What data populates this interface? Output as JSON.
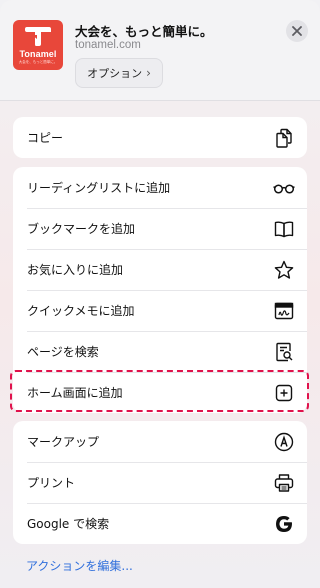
{
  "header": {
    "app_brand": "Tonamel",
    "app_tagline": "大会を、もっと簡単に。",
    "title": "大会を、もっと簡単に。",
    "url": "tonamel.com",
    "options_label": "オプション",
    "options_chevron": "›"
  },
  "groups": [
    {
      "items": [
        {
          "label": "コピー",
          "icon": "copy-icon"
        }
      ]
    },
    {
      "items": [
        {
          "label": "リーディングリストに追加",
          "icon": "glasses-icon"
        },
        {
          "label": "ブックマークを追加",
          "icon": "book-icon"
        },
        {
          "label": "お気に入りに追加",
          "icon": "star-icon"
        },
        {
          "label": "クイックメモに追加",
          "icon": "quick-note-icon"
        },
        {
          "label": "ページを検索",
          "icon": "find-in-page-icon"
        },
        {
          "label": "ホーム画面に追加",
          "icon": "plus-square-icon"
        }
      ]
    },
    {
      "items": [
        {
          "label": "マークアップ",
          "icon": "markup-pen-icon"
        },
        {
          "label": "プリント",
          "icon": "printer-icon"
        },
        {
          "label": "Google で検索",
          "icon": "google-icon"
        }
      ]
    }
  ],
  "footer": {
    "edit_actions": "アクションを編集..."
  },
  "colors": {
    "highlight": "#e0124c",
    "link": "#2f6fdc",
    "app_icon": "#e8473a"
  }
}
